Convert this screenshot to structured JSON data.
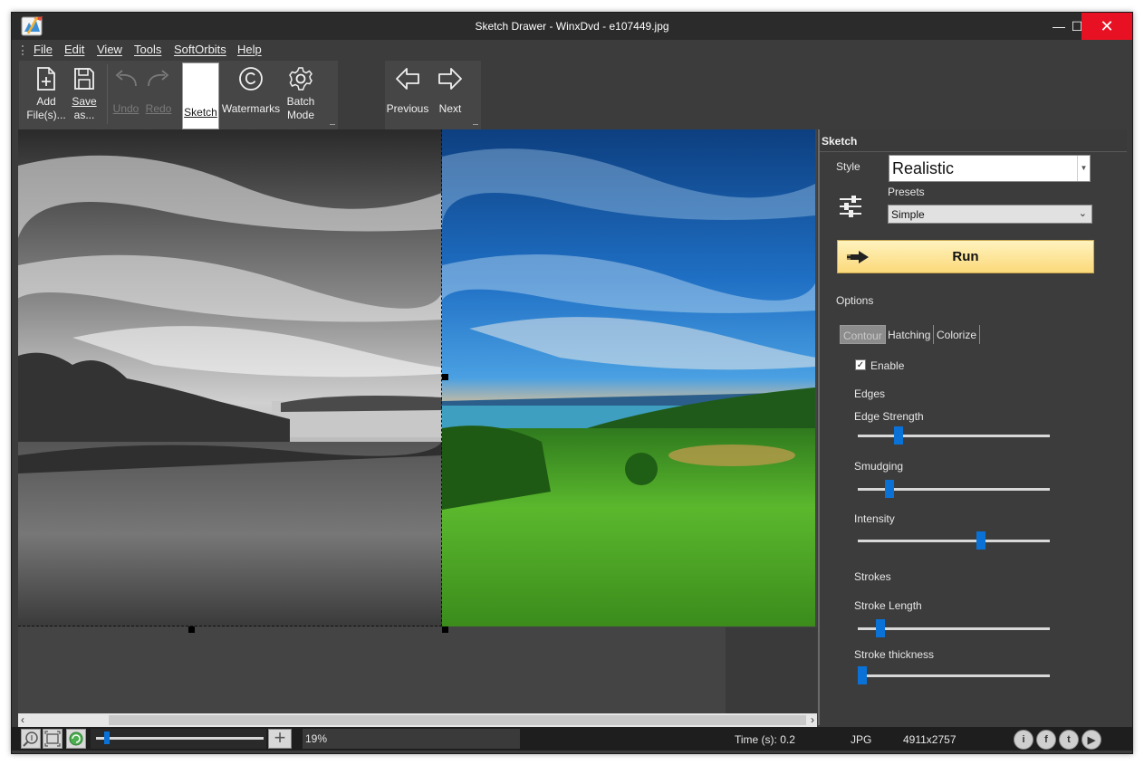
{
  "window": {
    "title": "Sketch Drawer - WinxDvd - e107449.jpg",
    "minimize": "—",
    "maximize": "☐",
    "close": "✕"
  },
  "menu": {
    "items": [
      "File",
      "Edit",
      "View",
      "Tools",
      "SoftOrbits",
      "Help"
    ]
  },
  "toolbar": {
    "add_files": [
      "Add",
      "File(s)..."
    ],
    "save_as": [
      "Save",
      "as..."
    ],
    "undo": "Undo",
    "redo": "Redo",
    "sketch": "Sketch",
    "watermarks": "Watermarks",
    "batch_mode": [
      "Batch",
      "Mode"
    ],
    "previous": "Previous",
    "next": "Next"
  },
  "panel": {
    "header": "Sketch",
    "style_label": "Style",
    "style_value": "Realistic",
    "presets_label": "Presets",
    "presets_value": "Simple",
    "run_label": "Run",
    "options_label": "Options",
    "tabs": [
      "Contour",
      "Hatching",
      "Colorize"
    ],
    "active_tab": "Contour",
    "enable_label": "Enable",
    "enable_checked": true,
    "edges_label": "Edges",
    "strokes_label": "Strokes",
    "sliders": {
      "edge_strength": {
        "label": "Edge Strength",
        "value": 0.2
      },
      "smudging": {
        "label": "Smudging",
        "value": 0.15
      },
      "intensity": {
        "label": "Intensity",
        "value": 0.65
      },
      "stroke_length": {
        "label": "Stroke Length",
        "value": 0.1
      },
      "stroke_thickness": {
        "label": "Stroke thickness",
        "value": 0.0
      }
    }
  },
  "statusbar": {
    "zoom_value": "19%",
    "zoom_level": 0.05,
    "time": "Time (s): 0.2",
    "format": "JPG",
    "dimensions": "4911x2757",
    "icons": [
      "zoom-in-icon",
      "fit-screen-icon",
      "rotate-icon",
      "info-icon",
      "facebook-icon",
      "twitter-icon",
      "youtube-icon"
    ]
  },
  "colors": {
    "accent_blue": "#0a72d6",
    "run_button": "#fbd97a",
    "close_red": "#e81123"
  }
}
